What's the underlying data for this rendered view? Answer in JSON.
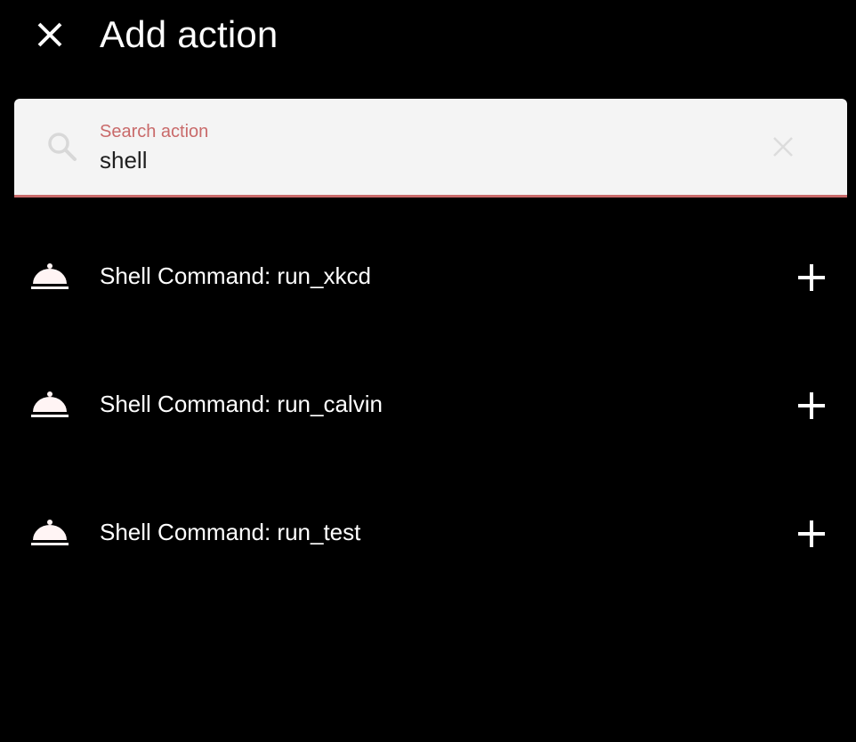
{
  "header": {
    "title": "Add action",
    "close_icon": "close-icon"
  },
  "search": {
    "label": "Search action",
    "value": "shell",
    "search_icon": "search-icon",
    "clear_icon": "clear-icon"
  },
  "actions": [
    {
      "label": "Shell Command: run_xkcd",
      "icon": "service-bell-icon",
      "add_icon": "plus-icon"
    },
    {
      "label": "Shell Command: run_calvin",
      "icon": "service-bell-icon",
      "add_icon": "plus-icon"
    },
    {
      "label": "Shell Command: run_test",
      "icon": "service-bell-icon",
      "add_icon": "plus-icon"
    }
  ],
  "colors": {
    "background": "#000000",
    "accent": "#c96a6a",
    "search_background": "#f4f4f4",
    "text": "#ffffff"
  }
}
